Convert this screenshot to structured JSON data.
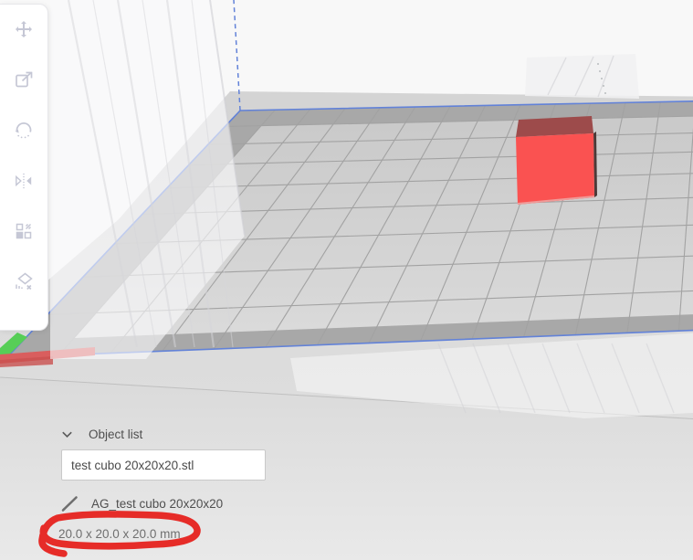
{
  "toolbar": {
    "tools": [
      {
        "icon": "move-icon"
      },
      {
        "icon": "scale-icon"
      },
      {
        "icon": "rotate-icon"
      },
      {
        "icon": "mirror-icon"
      },
      {
        "icon": "arrange-icon"
      },
      {
        "icon": "lay-flat-icon"
      }
    ]
  },
  "object_list": {
    "header_label": "Object list",
    "file_name": "test cubo 20x20x20.stl",
    "part_label": "AG_test cubo 20x20x20",
    "dimensions_label": "20.0 x 20.0 x 20.0 mm"
  },
  "scene": {
    "background": "#f8f8f8",
    "plate_outline_color": "#6282d8",
    "grid_line_color": "#a2a2a2",
    "plate_back_color": "#c9c9c9",
    "plate_front_color": "#dcdcdc",
    "band_color": "#a8a8a8",
    "cube_front_color": "#fa5251",
    "cube_top_color": "#9d4b4b",
    "cube_side_color": "#4c3a38",
    "axis_x_color": "#d95e5e",
    "axis_y_color": "#57ce57"
  },
  "annotation": {
    "shape": "hand-drawn-ellipse",
    "color": "#e62420"
  }
}
